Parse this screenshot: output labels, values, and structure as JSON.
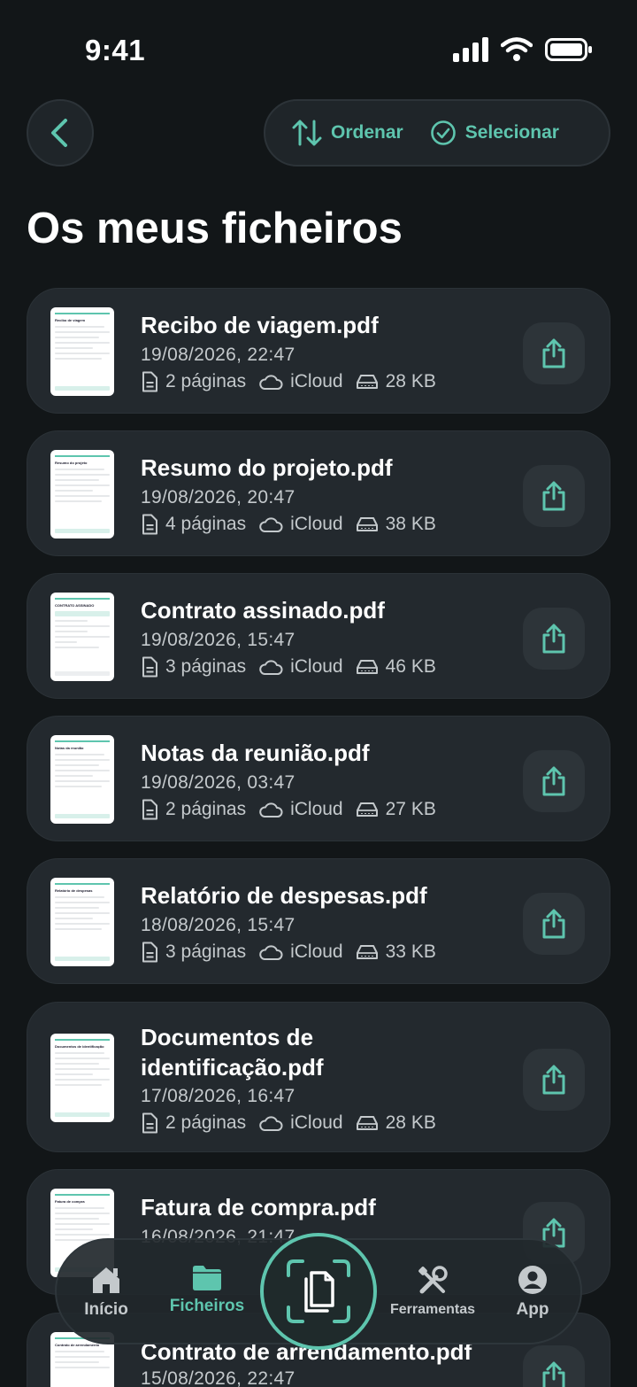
{
  "status_bar": {
    "time": "9:41"
  },
  "toolbar": {
    "sort_label": "Ordenar",
    "select_label": "Selecionar"
  },
  "page": {
    "title": "Os meus ficheiros"
  },
  "files": [
    {
      "name": "Recibo de viagem.pdf",
      "thumb_title": "Recibo de viagem",
      "date": "19/08/2026, 22:47",
      "pages": "2 páginas",
      "storage": "iCloud",
      "size": "28 KB"
    },
    {
      "name": "Resumo do projeto.pdf",
      "thumb_title": "Resumo do projeto",
      "date": "19/08/2026, 20:47",
      "pages": "4 páginas",
      "storage": "iCloud",
      "size": "38 KB"
    },
    {
      "name": "Contrato assinado.pdf",
      "thumb_title": "CONTRATO ASSINADO",
      "date": "19/08/2026, 15:47",
      "pages": "3 páginas",
      "storage": "iCloud",
      "size": "46 KB"
    },
    {
      "name": "Notas da reunião.pdf",
      "thumb_title": "Notas da reunião",
      "date": "19/08/2026, 03:47",
      "pages": "2 páginas",
      "storage": "iCloud",
      "size": "27 KB"
    },
    {
      "name": "Relatório de despesas.pdf",
      "thumb_title": "Relatório de despesas",
      "date": "18/08/2026, 15:47",
      "pages": "3 páginas",
      "storage": "iCloud",
      "size": "33 KB"
    },
    {
      "name_line1": "Documentos de",
      "name_line2": "identificação.pdf",
      "thumb_title": "Documentos de identificação",
      "date": "17/08/2026, 16:47",
      "pages": "2 páginas",
      "storage": "iCloud",
      "size": "28 KB"
    },
    {
      "name": "Fatura de compra.pdf",
      "thumb_title": "Fatura de compra",
      "date": "16/08/2026, 21:47"
    },
    {
      "name": "Contrato de arrendamento.pdf",
      "thumb_title": "Contrato de arrendamento",
      "date": "15/08/2026, 22:47"
    }
  ],
  "tabs": [
    {
      "label": "Início",
      "icon": "home-icon"
    },
    {
      "label": "Ficheiros",
      "icon": "folder-icon"
    },
    {
      "label": "Ferramentas",
      "icon": "tools-icon"
    },
    {
      "label": "App",
      "icon": "account-icon"
    }
  ],
  "colors": {
    "accent": "#5ec5ae",
    "background": "#121618",
    "card": "#23292e"
  }
}
